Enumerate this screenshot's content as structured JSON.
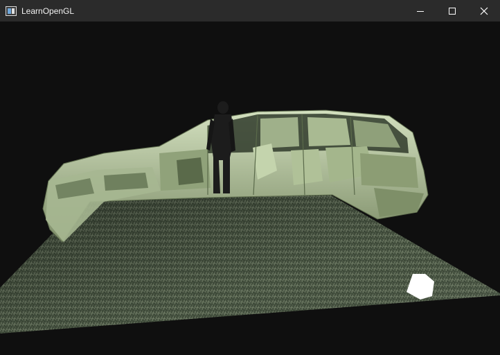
{
  "window": {
    "title": "LearnOpenGL",
    "app_icon": "app-window-icon",
    "controls": [
      {
        "name": "minimize-button",
        "icon": "minimize-icon"
      },
      {
        "name": "maximize-button",
        "icon": "maximize-icon"
      },
      {
        "name": "close-button",
        "icon": "close-icon"
      }
    ]
  },
  "scene": {
    "background_color": "#0f0f0f",
    "floor_color": "#4c5a46",
    "car_color": "#b9c9a4",
    "character_color": "#1c1c1c",
    "light_cube_color": "#ffffff",
    "objects": [
      "grass-floor",
      "suv-car-model",
      "character-model",
      "light-cube"
    ]
  }
}
